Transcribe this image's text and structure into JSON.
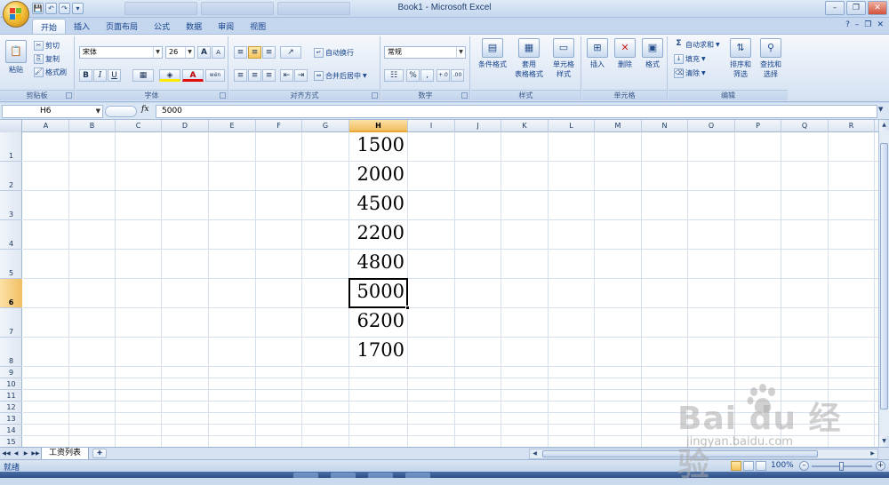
{
  "window": {
    "title": "Book1 - Microsoft Excel",
    "minimize": "–",
    "restore": "❐",
    "close": "✕"
  },
  "quick_access": [
    "💾",
    "↶",
    "↷",
    "▾"
  ],
  "ribbon_tabs": [
    "开始",
    "插入",
    "页面布局",
    "公式",
    "数据",
    "审阅",
    "视图"
  ],
  "active_tab_index": 0,
  "help_icons": [
    "?",
    "–",
    "❐",
    "✕"
  ],
  "ribbon": {
    "clipboard": {
      "label": "剪贴板",
      "paste": "粘贴",
      "cut": "剪切",
      "copy": "复制",
      "format_painter": "格式刷"
    },
    "font": {
      "label": "字体",
      "font_name": "宋体",
      "font_size": "26",
      "grow": "A",
      "shrink": "A",
      "bold": "B",
      "italic": "I",
      "underline": "U",
      "border": "▦",
      "fill": "◈",
      "font_color": "A",
      "phonetic": "wén"
    },
    "alignment": {
      "label": "对齐方式",
      "wrap_text": "自动换行",
      "merge_center": "合并后居中"
    },
    "number": {
      "label": "数字",
      "format": "常规",
      "currency": "☷",
      "percent": "%",
      "comma": ",",
      "inc_decimal": "+.0",
      "dec_decimal": ".00"
    },
    "styles": {
      "label": "样式",
      "conditional": "条件格式",
      "table_format_1": "套用",
      "table_format_2": "表格格式",
      "cell_styles_1": "单元格",
      "cell_styles_2": "样式"
    },
    "cells": {
      "label": "单元格",
      "insert": "插入",
      "delete": "删除",
      "format": "格式"
    },
    "editing": {
      "label": "编辑",
      "autosum": "自动求和",
      "fill": "填充",
      "clear": "清除",
      "sort_1": "排序和",
      "sort_2": "筛选",
      "find_1": "查找和",
      "find_2": "选择"
    }
  },
  "formula_bar": {
    "name_box": "H6",
    "fx": "fx",
    "content": "5000"
  },
  "grid": {
    "columns": [
      "A",
      "B",
      "C",
      "D",
      "E",
      "F",
      "G",
      "H",
      "I",
      "J",
      "K",
      "L",
      "M",
      "N",
      "O",
      "P",
      "Q",
      "R"
    ],
    "rows": [
      "1",
      "2",
      "3",
      "4",
      "5",
      "6",
      "7",
      "8",
      "9",
      "10",
      "11",
      "12",
      "13",
      "14",
      "15"
    ],
    "selected_column": "H",
    "selected_row": "6",
    "column_H_values": [
      "1500",
      "2000",
      "4500",
      "2200",
      "4800",
      "5000",
      "6200",
      "1700"
    ]
  },
  "sheets": {
    "tabs": [
      "工资列表"
    ],
    "nav": [
      "◀◀",
      "◀",
      "▶",
      "▶▶"
    ]
  },
  "status": {
    "text": "就绪",
    "zoom": "100%",
    "zoom_out": "–",
    "zoom_in": "+"
  },
  "watermark": {
    "main": "Bai du 经验",
    "sub": "jingyan.baidu.com"
  }
}
